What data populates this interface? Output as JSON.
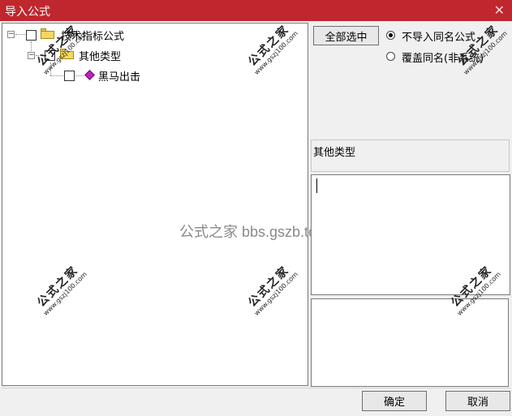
{
  "window": {
    "title": "导入公式",
    "close_glyph": "✕"
  },
  "tree": {
    "root": {
      "label": "技术指标公式",
      "expander": "−"
    },
    "child": {
      "label": "其他类型",
      "expander": "−"
    },
    "leaf": {
      "label": "黑马出击"
    }
  },
  "toolbar": {
    "select_all_label": "全部选中"
  },
  "options": {
    "no_import_label": "不导入同名公式",
    "overwrite_label": "覆盖同名(非系统)"
  },
  "info": {
    "category": "其他类型",
    "description": "",
    "notes": ""
  },
  "footer": {
    "ok_label": "确定",
    "cancel_label": "取消"
  },
  "watermark": {
    "brand": "公式之家",
    "site": "www.gszj100.com",
    "center": "公式之家 bbs.gszb.top"
  },
  "colors": {
    "titlebar": "#c0262d",
    "leaf_icon": "#c020c0",
    "folder": "#f5d75a"
  }
}
